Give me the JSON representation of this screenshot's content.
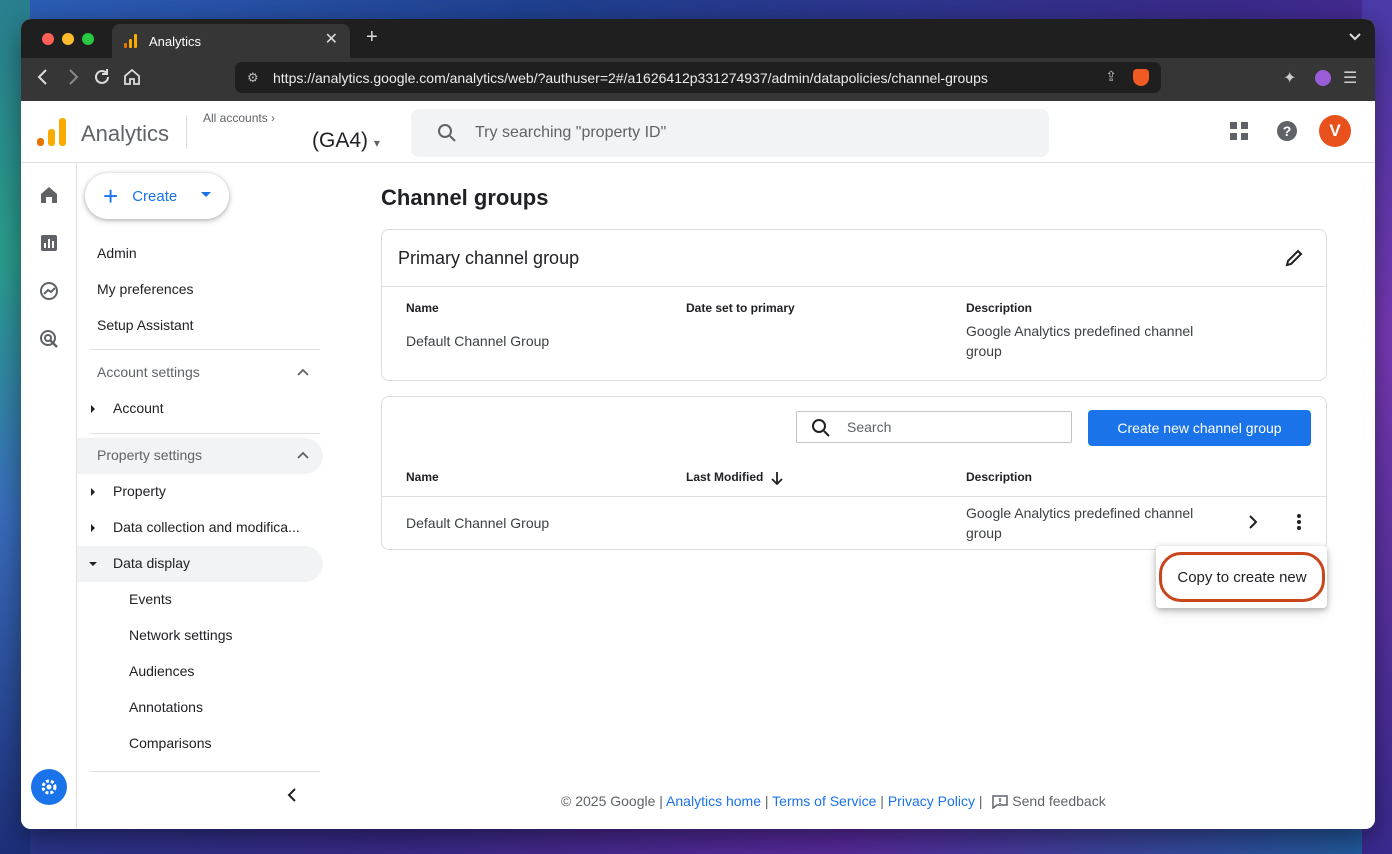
{
  "browser": {
    "tab_title": "Analytics",
    "url": "https://analytics.google.com/analytics/web/?authuser=2#/a1626412p331274937/admin/datapolicies/channel-groups"
  },
  "header": {
    "app_name": "Analytics",
    "all_accounts": "All accounts",
    "property_name": "(GA4)",
    "search_placeholder": "Try searching \"property ID\"",
    "avatar_initial": "V",
    "avatar_color": "#e8511b"
  },
  "sidebar": {
    "create_label": "Create",
    "items": {
      "admin": "Admin",
      "preferences": "My preferences",
      "setup": "Setup Assistant"
    },
    "account_settings": {
      "heading": "Account settings",
      "account": "Account"
    },
    "property_settings": {
      "heading": "Property settings",
      "property": "Property",
      "data_collection": "Data collection and modifica...",
      "data_display": "Data display",
      "sub": {
        "events": "Events",
        "network": "Network settings",
        "audiences": "Audiences",
        "annotations": "Annotations",
        "comparisons": "Comparisons"
      }
    }
  },
  "main": {
    "page_title": "Channel groups",
    "primary": {
      "title": "Primary channel group",
      "columns": {
        "name": "Name",
        "date": "Date set to primary",
        "description": "Description"
      },
      "row": {
        "name": "Default Channel Group",
        "date": "",
        "description": "Google Analytics predefined channel group"
      }
    },
    "table": {
      "search_placeholder": "Search",
      "create_button": "Create new channel group",
      "columns": {
        "name": "Name",
        "modified": "Last Modified",
        "description": "Description"
      },
      "row": {
        "name": "Default Channel Group",
        "modified": "",
        "description": "Google Analytics predefined channel group"
      }
    },
    "context_menu": {
      "copy": "Copy to create new"
    }
  },
  "footer": {
    "copyright": "© 2025 Google |",
    "home": "Analytics home",
    "terms": "Terms of Service",
    "privacy": "Privacy Policy",
    "feedback": "Send feedback"
  },
  "colors": {
    "accent": "#1a73e8",
    "highlight_ring": "#c9461c",
    "ga_orange": "#f9ab00",
    "ga_dark_orange": "#e37400"
  }
}
